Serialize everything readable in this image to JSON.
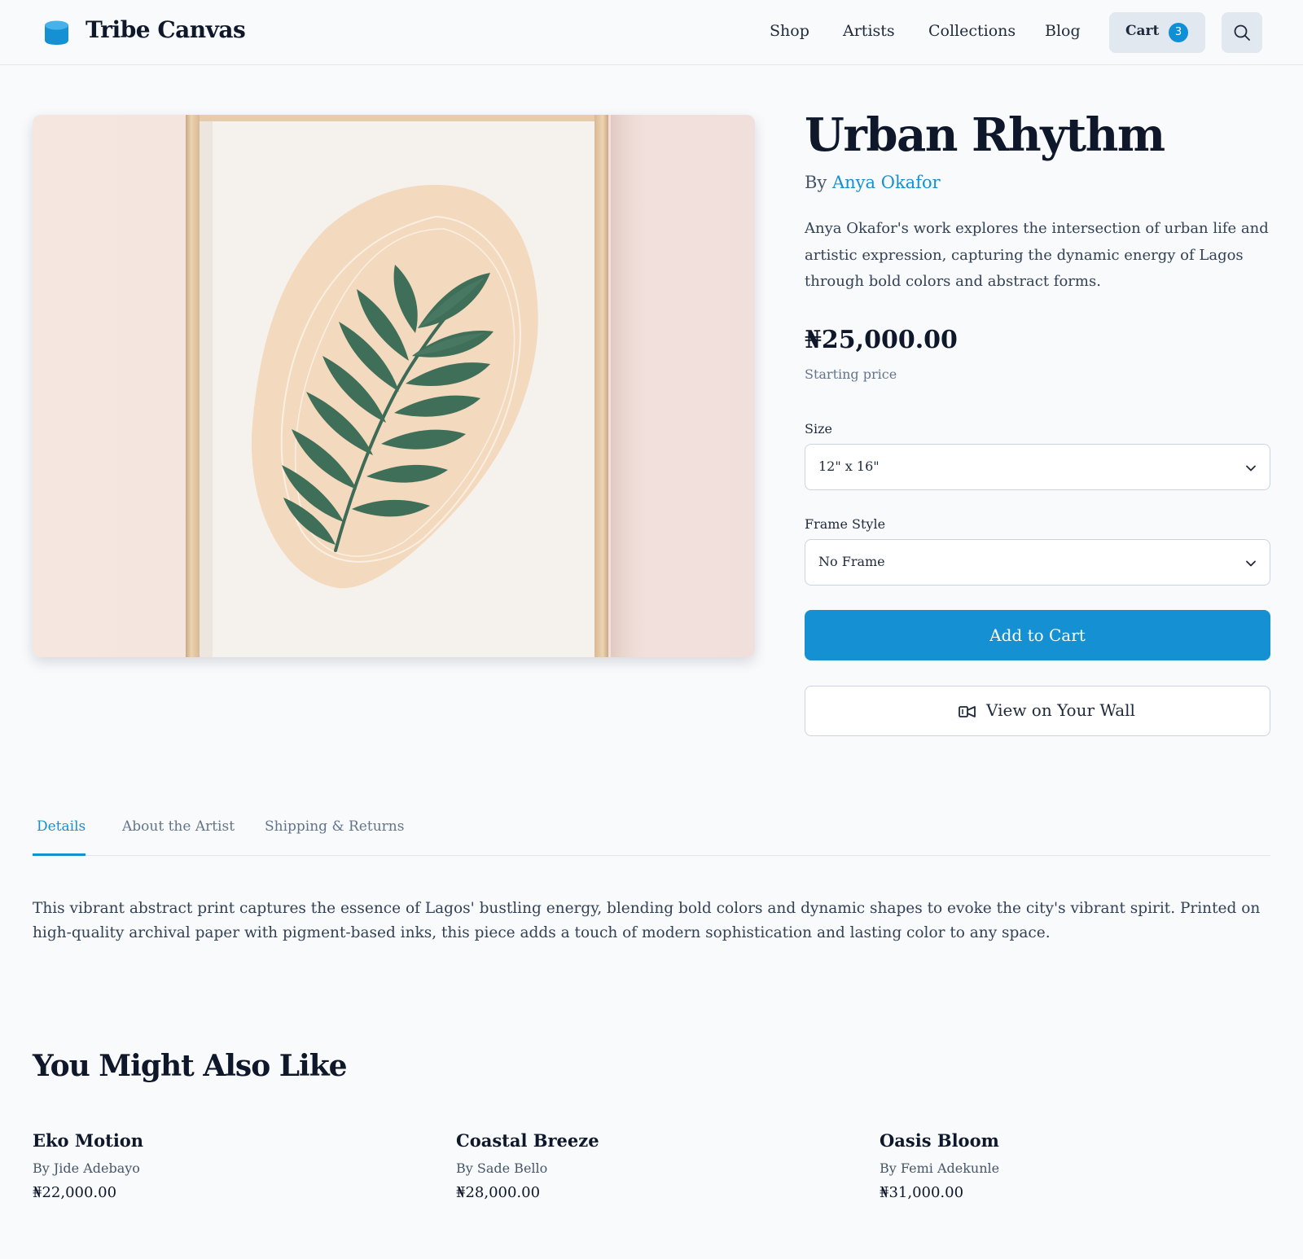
{
  "brand": {
    "name": "Tribe Canvas",
    "accent": "#1590d3"
  },
  "nav": {
    "links": [
      "Shop",
      "Artists",
      "Collections",
      "Blog"
    ]
  },
  "cart": {
    "label": "Cart",
    "count": "3"
  },
  "product": {
    "title": "Urban Rhythm",
    "by_prefix": "By",
    "artist": "Anya Okafor",
    "description": "Anya Okafor's work explores the intersection of urban life and artistic expression, capturing the dynamic energy of Lagos through bold colors and abstract forms.",
    "price": "₦25,000.00",
    "price_note": "Starting price",
    "size_label": "Size",
    "size_value": "12\" x 16\"",
    "frame_label": "Frame Style",
    "frame_value": "No Frame",
    "add_to_cart": "Add to Cart",
    "view_on_wall": "View on Your Wall"
  },
  "tabs": {
    "items": [
      "Details",
      "About the Artist",
      "Shipping & Returns"
    ],
    "active": "Details",
    "details_text": "This vibrant abstract print captures the essence of Lagos' bustling energy, blending bold colors and dynamic shapes to evoke the city's vibrant spirit. Printed on high-quality archival paper with pigment-based inks, this piece adds a touch of modern sophistication and lasting color to any space."
  },
  "recommendations": {
    "heading": "You Might Also Like",
    "items": [
      {
        "title": "Eko Motion",
        "artist": "By Jide Adebayo",
        "price": "₦22,000.00"
      },
      {
        "title": "Coastal Breeze",
        "artist": "By Sade Bello",
        "price": "₦28,000.00"
      },
      {
        "title": "Oasis Bloom",
        "artist": "By Femi Adekunle",
        "price": "₦31,000.00"
      }
    ]
  }
}
